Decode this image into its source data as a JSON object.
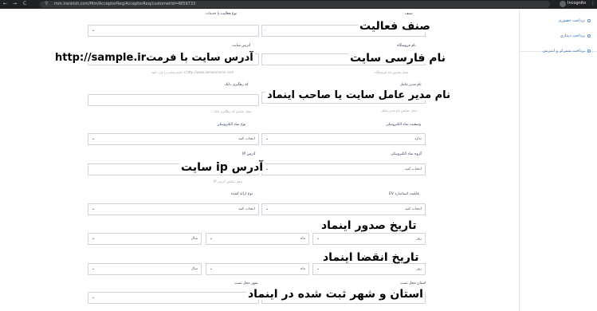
{
  "browser": {
    "back": "←",
    "forward": "→",
    "reload": "C",
    "url": "mm.irankish.com/Mm/AcceptorReq/AcceptorReq/customerId=4859733",
    "incognito_label": "Incognito"
  },
  "sidebar": {
    "items": [
      {
        "label": "پرداخت حضوری"
      },
      {
        "label": "پرداخت دیداری"
      },
      {
        "label": "پرداخت متمرکز و اینترنتی"
      }
    ]
  },
  "form": {
    "activity_type": {
      "label": "نوع فعالیت یا خدمات"
    },
    "category": {
      "label": "صنف",
      "value": "-"
    },
    "store_name": {
      "label": "نام فروشگاه",
      "help": "محل نمایش نام فروشگاه"
    },
    "website": {
      "label": "آدرس سایت",
      "help": "http://www.domainname.com یا دامنه سایت را وارد کنید"
    },
    "tracking_code": {
      "label": "کد رهگیری بانک",
      "help": "محل نمایش کد رهگیری بانک"
    },
    "manager_name": {
      "label": "نام مدیر عامل",
      "help": "محل نمایش نام مدیر عامل"
    },
    "enamad_type": {
      "label": "نوع نماد الکترونیکی",
      "value": "انتخاب کنید"
    },
    "enamad_status": {
      "label": "وضعیت نماد الکترونیکی",
      "value": "ندارد"
    },
    "ip_address": {
      "label": "آدرس IP",
      "help": "محل نمایش آدرس IP"
    },
    "enamad_group": {
      "label": "گروه نماد الکترونیکی",
      "value": "انتخاب کنید"
    },
    "provider_type": {
      "label": "نوع ارائه کننده",
      "value": "انتخاب کنید"
    },
    "ev_standard": {
      "label": "قابلیت استاندارد EV",
      "value": "انتخاب کنید"
    },
    "issue_date": {
      "label": "تاریخ صدور نماد",
      "year": "سال",
      "month": "ماه",
      "day": "روز"
    },
    "expiry_date": {
      "label": "تاریخ انقضاء نماد",
      "year": "سال",
      "month": "ماه",
      "day": "روز"
    },
    "city": {
      "label": "شهر محل نصب"
    },
    "province": {
      "label": "استان محل نصب"
    }
  },
  "overlays": {
    "category": "صنف فعالیت",
    "website": "آدرس سایت با فرمتhttp://sample.ir",
    "store_name": "نام فارسی سایت",
    "manager": "نام مدیر عامل سایت یا صاحب اینماد",
    "ip": "آدرس ip سایت",
    "issue": "تاریخ صدور اینماد",
    "expiry": "تاریخ انقضا اینماد",
    "location": "استان و شهر ثبت شده در اینماد"
  }
}
